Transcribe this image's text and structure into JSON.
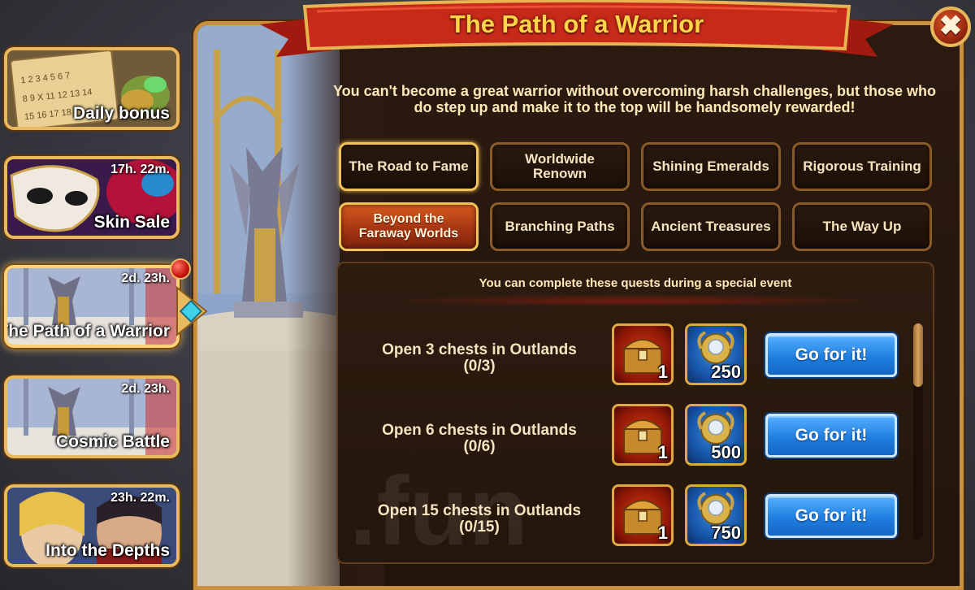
{
  "sidebar": {
    "items": [
      {
        "label": "Daily bonus",
        "timer": ""
      },
      {
        "label": "Skin Sale",
        "timer": "17h. 22m."
      },
      {
        "label": "The Path of a Warrior",
        "timer": "2d. 23h."
      },
      {
        "label": "Cosmic Battle",
        "timer": "2d. 23h."
      },
      {
        "label": "Into the Depths",
        "timer": "23h. 22m."
      }
    ]
  },
  "panel": {
    "title": "The Path of a Warrior",
    "close_glyph": "✖",
    "intro": "You can't become a great warrior without overcoming harsh challenges, but those who do step up and make it to the top will be handsomely rewarded!"
  },
  "tabs": [
    {
      "label": "The Road to Fame"
    },
    {
      "label": "Worldwide Renown"
    },
    {
      "label": "Shining Emeralds"
    },
    {
      "label": "Rigorous Training"
    },
    {
      "label": "Beyond the Faraway Worlds"
    },
    {
      "label": "Branching Paths"
    },
    {
      "label": "Ancient Treasures"
    },
    {
      "label": "The Way Up"
    }
  ],
  "quests": {
    "note": "You can complete these quests during a special event",
    "items": [
      {
        "title": "Open 3 chests in Outlands",
        "progress": "(0/3)",
        "chest_amount": "1",
        "coin_amount": "250",
        "button": "Go for it!"
      },
      {
        "title": "Open 6 chests in Outlands",
        "progress": "(0/6)",
        "chest_amount": "1",
        "coin_amount": "500",
        "button": "Go for it!"
      },
      {
        "title": "Open 15 chests in Outlands",
        "progress": "(0/15)",
        "chest_amount": "1",
        "coin_amount": "750",
        "button": "Go for it!"
      }
    ]
  },
  "colors": {
    "gold_title": "#ffd34a",
    "frame_gold": "#c9913d",
    "button_blue": "#1f7fe0",
    "active_tab_red": "#a63511"
  },
  "icons": [
    "close-icon",
    "chest-icon",
    "coin-icon",
    "notification-dot",
    "gem-pointer-icon"
  ]
}
